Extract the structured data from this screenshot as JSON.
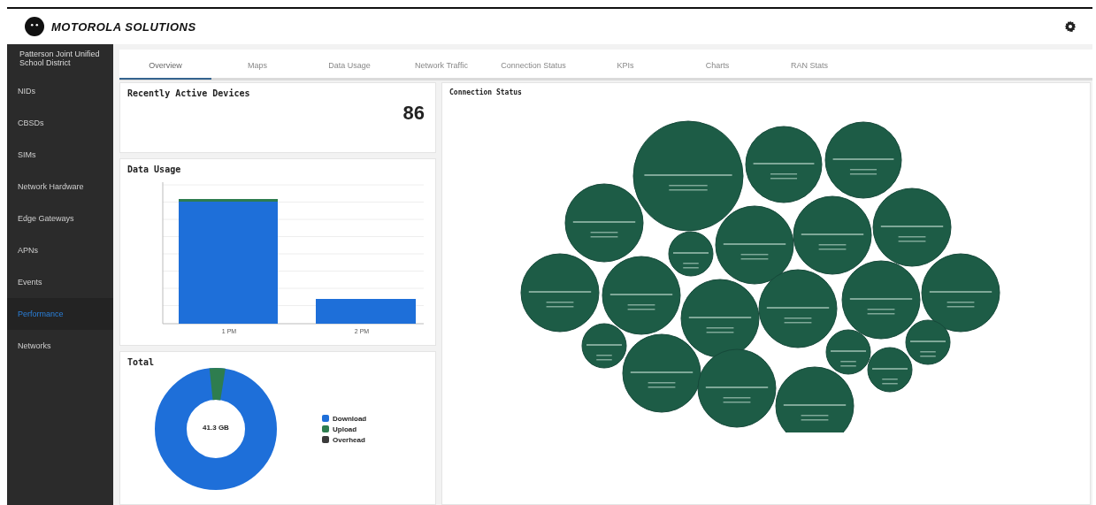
{
  "header": {
    "brand": "MOTOROLA SOLUTIONS"
  },
  "sidebar": {
    "account": "Patterson Joint Unified School District",
    "items": [
      {
        "label": "NIDs",
        "selected": false
      },
      {
        "label": "CBSDs",
        "selected": false
      },
      {
        "label": "SIMs",
        "selected": false
      },
      {
        "label": "Network Hardware",
        "selected": false
      },
      {
        "label": "Edge Gateways",
        "selected": false
      },
      {
        "label": "APNs",
        "selected": false
      },
      {
        "label": "Events",
        "selected": false
      },
      {
        "label": "Performance",
        "selected": true
      },
      {
        "label": "Networks",
        "selected": false
      }
    ]
  },
  "tabs": [
    {
      "label": "Overview",
      "selected": true
    },
    {
      "label": "Maps",
      "selected": false
    },
    {
      "label": "Data Usage",
      "selected": false
    },
    {
      "label": "Network Traffic",
      "selected": false
    },
    {
      "label": "Connection Status",
      "selected": false
    },
    {
      "label": "KPIs",
      "selected": false
    },
    {
      "label": "Charts",
      "selected": false
    },
    {
      "label": "RAN Stats",
      "selected": false
    }
  ],
  "active_devices": {
    "title": "Recently Active Devices",
    "count": "86"
  },
  "data_usage": {
    "title": "Data Usage",
    "categories": [
      "1 PM",
      "2 PM"
    ]
  },
  "total": {
    "title": "Total",
    "center": "41.3 GB",
    "legend": [
      {
        "label": "Download",
        "color": "#1e6fd9"
      },
      {
        "label": "Upload",
        "color": "#2e7d4f"
      },
      {
        "label": "Overhead",
        "color": "#3a3a3a"
      }
    ]
  },
  "connection_status": {
    "title": "Connection Status"
  }
}
